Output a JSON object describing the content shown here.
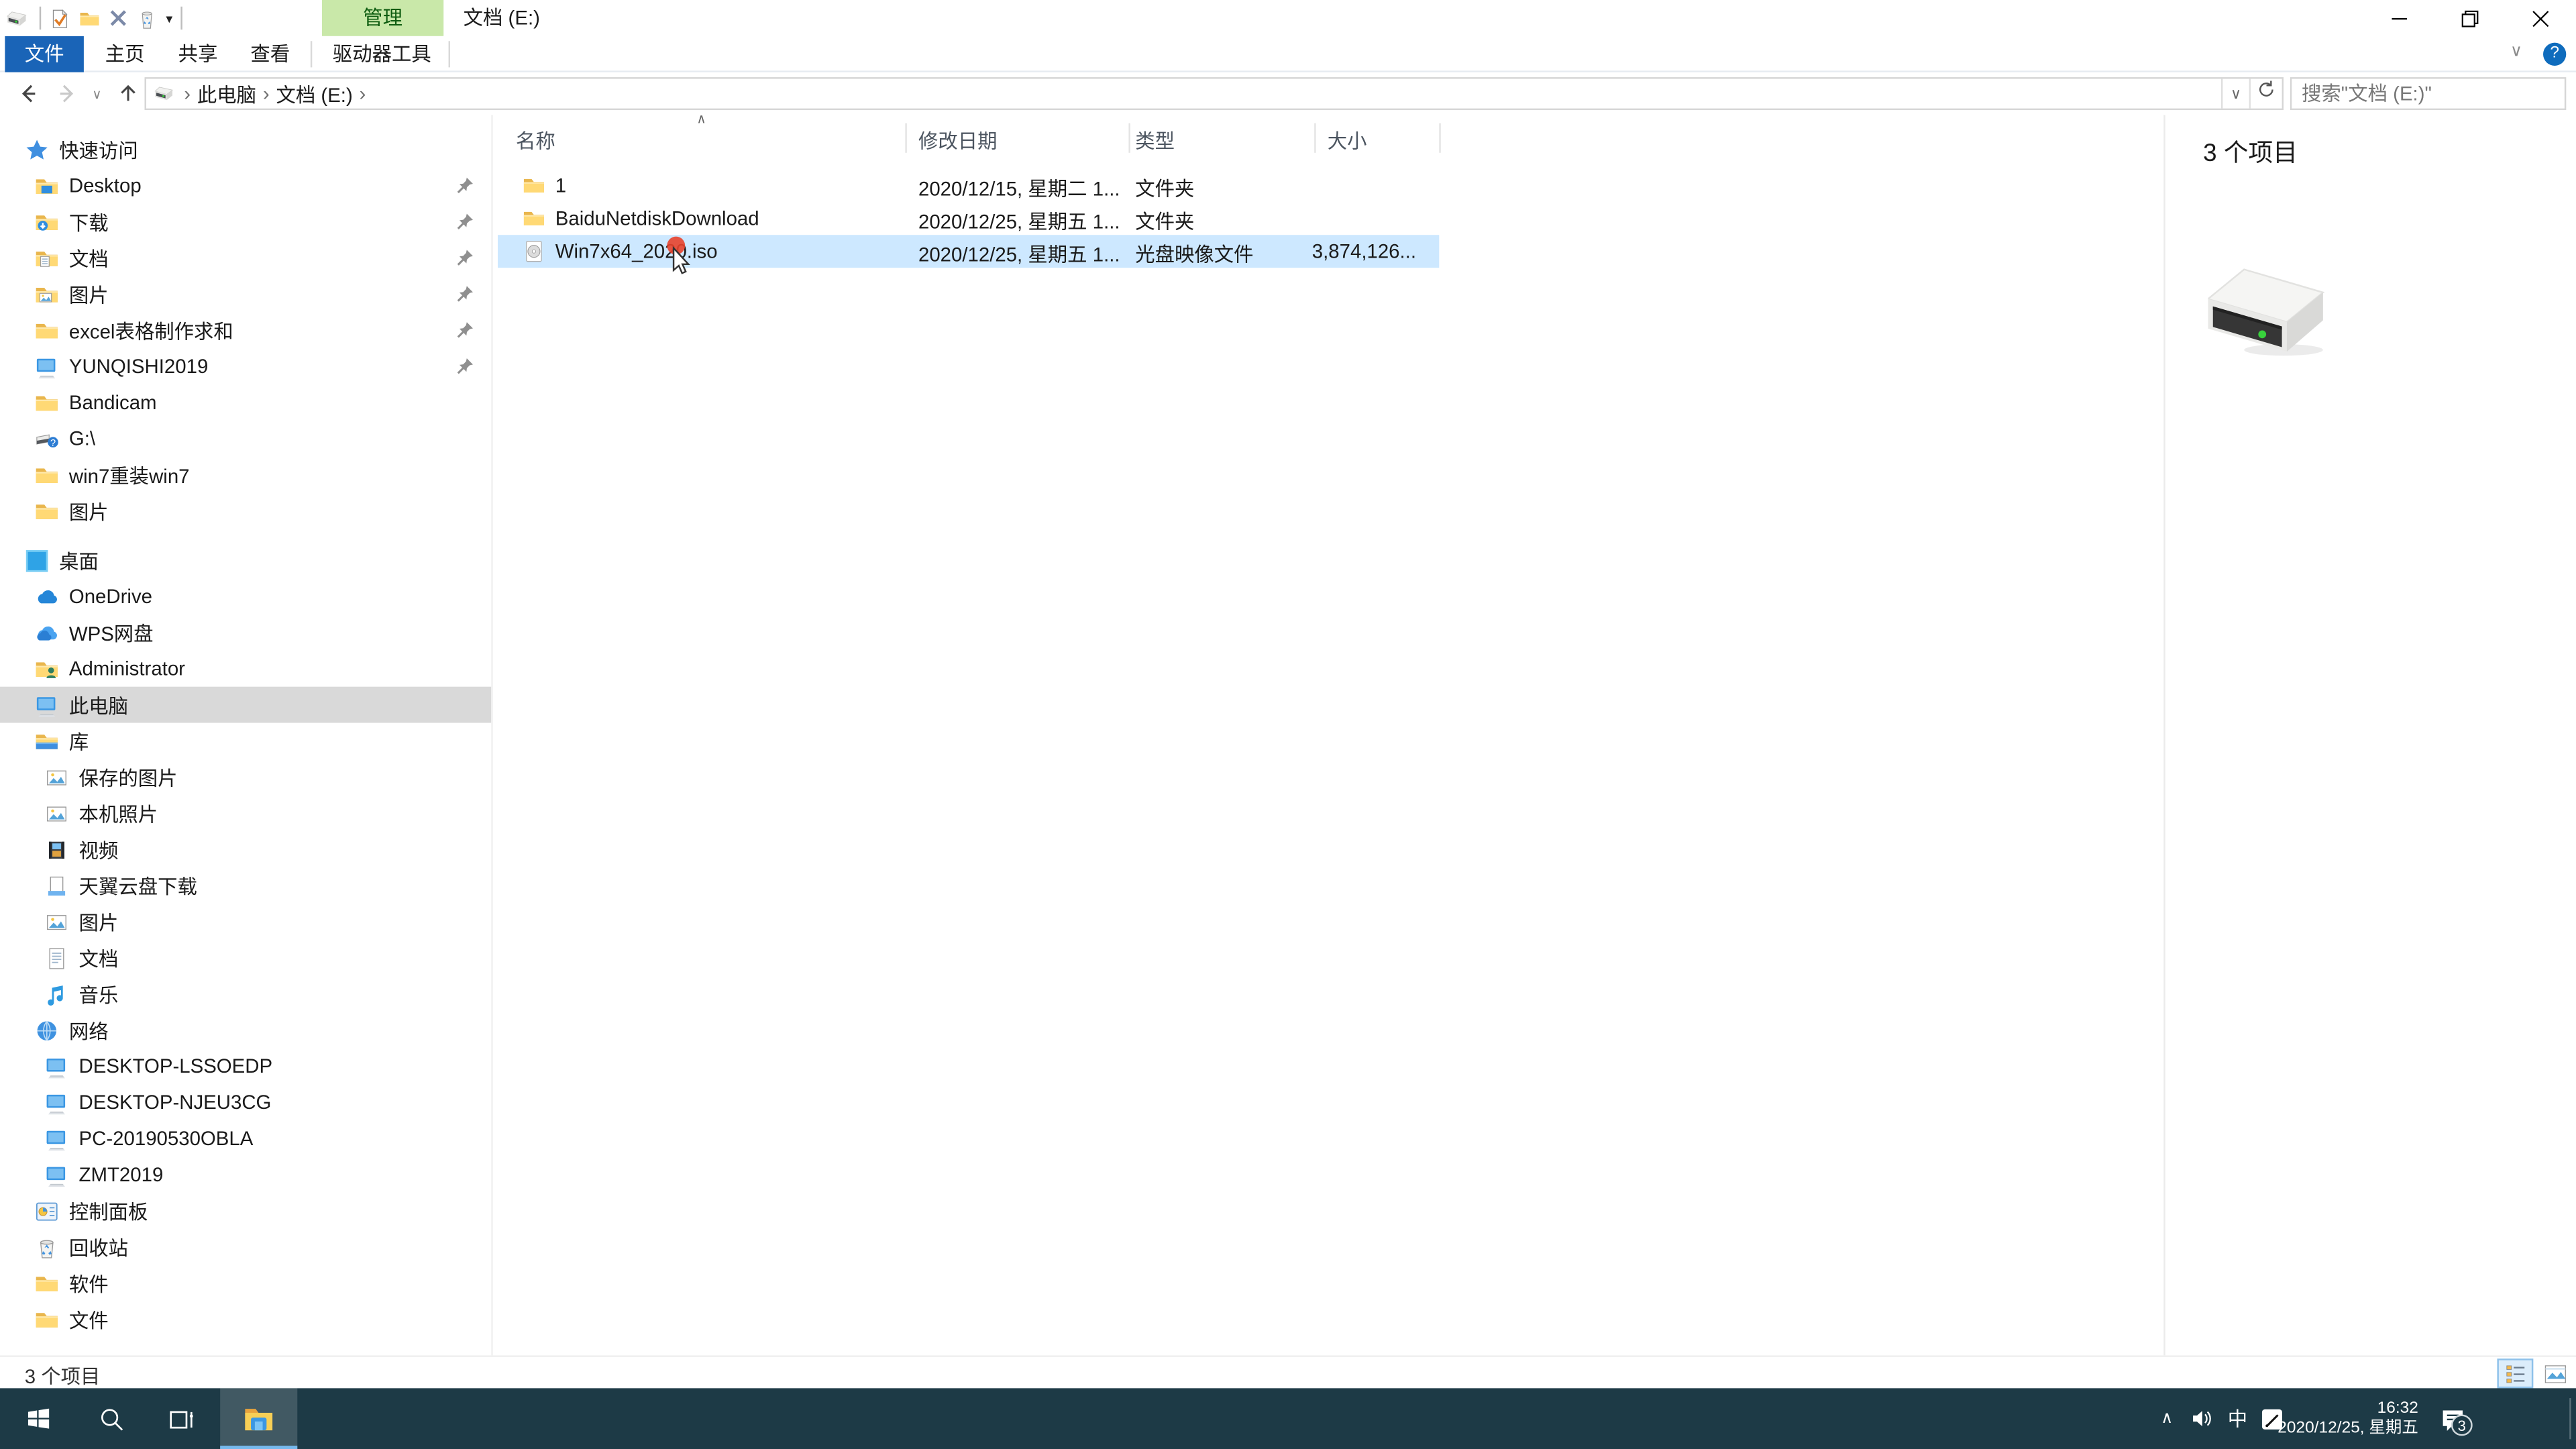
{
  "titlebar": {
    "contextual_header": "管理",
    "title": "文档 (E:)"
  },
  "ribbon": {
    "file_tab": "文件",
    "tabs": [
      "主页",
      "共享",
      "查看"
    ],
    "contextual_tab": "驱动器工具",
    "help_label": "?"
  },
  "nav": {
    "crumbs": [
      "此电脑",
      "文档 (E:)"
    ],
    "crumb_chevron": "›",
    "search_placeholder": "搜索\"文档 (E:)\""
  },
  "sidebar": {
    "items": [
      {
        "label": "快速访问",
        "icon": "star",
        "cls": "lv0",
        "pinned": false
      },
      {
        "label": "Desktop",
        "icon": "folder-desktop",
        "cls": "lv1",
        "pinned": true
      },
      {
        "label": "下载",
        "icon": "folder-down",
        "cls": "lv1",
        "pinned": true
      },
      {
        "label": "文档",
        "icon": "folder-doc",
        "cls": "lv1",
        "pinned": true
      },
      {
        "label": "图片",
        "icon": "folder-pic",
        "cls": "lv1",
        "pinned": true
      },
      {
        "label": "excel表格制作求和",
        "icon": "folder",
        "cls": "lv1",
        "pinned": true
      },
      {
        "label": "YUNQISHI2019",
        "icon": "pc",
        "cls": "lv1",
        "pinned": true
      },
      {
        "label": "Bandicam",
        "icon": "folder",
        "cls": "lv1",
        "pinned": false
      },
      {
        "label": "G:\\",
        "icon": "usb",
        "cls": "lv1",
        "pinned": false
      },
      {
        "label": "win7重装win7",
        "icon": "folder",
        "cls": "lv1",
        "pinned": false
      },
      {
        "label": "图片",
        "icon": "folder",
        "cls": "lv1",
        "pinned": false
      },
      {
        "label": "桌面",
        "icon": "desktop",
        "cls": "lv0 gap",
        "pinned": false
      },
      {
        "label": "OneDrive",
        "icon": "cloud",
        "cls": "lv1",
        "pinned": false
      },
      {
        "label": "WPS网盘",
        "icon": "wps",
        "cls": "lv1",
        "pinned": false
      },
      {
        "label": "Administrator",
        "icon": "folder-user",
        "cls": "lv1",
        "pinned": false
      },
      {
        "label": "此电脑",
        "icon": "pc",
        "cls": "lv1 selected-side",
        "pinned": false
      },
      {
        "label": "库",
        "icon": "library",
        "cls": "lv1",
        "pinned": false
      },
      {
        "label": "保存的图片",
        "icon": "pic",
        "cls": "lv2",
        "pinned": false
      },
      {
        "label": "本机照片",
        "icon": "pic",
        "cls": "lv2",
        "pinned": false
      },
      {
        "label": "视频",
        "icon": "video",
        "cls": "lv2",
        "pinned": false
      },
      {
        "label": "天翼云盘下载",
        "icon": "dl",
        "cls": "lv2",
        "pinned": false
      },
      {
        "label": "图片",
        "icon": "pic",
        "cls": "lv2",
        "pinned": false
      },
      {
        "label": "文档",
        "icon": "doc",
        "cls": "lv2",
        "pinned": false
      },
      {
        "label": "音乐",
        "icon": "music",
        "cls": "lv2",
        "pinned": false
      },
      {
        "label": "网络",
        "icon": "globe",
        "cls": "lv1",
        "pinned": false
      },
      {
        "label": "DESKTOP-LSSOEDP",
        "icon": "pc",
        "cls": "lv2",
        "pinned": false
      },
      {
        "label": "DESKTOP-NJEU3CG",
        "icon": "pc",
        "cls": "lv2",
        "pinned": false
      },
      {
        "label": "PC-20190530OBLA",
        "icon": "pc",
        "cls": "lv2",
        "pinned": false
      },
      {
        "label": "ZMT2019",
        "icon": "pc",
        "cls": "lv2",
        "pinned": false
      },
      {
        "label": "控制面板",
        "icon": "cpanel",
        "cls": "lv1",
        "pinned": false
      },
      {
        "label": "回收站",
        "icon": "bin",
        "cls": "lv1",
        "pinned": false
      },
      {
        "label": "软件",
        "icon": "folder",
        "cls": "lv1",
        "pinned": false
      },
      {
        "label": "文件",
        "icon": "folder",
        "cls": "lv1",
        "pinned": false
      }
    ]
  },
  "files": {
    "columns": [
      "名称",
      "修改日期",
      "类型",
      "大小"
    ],
    "sort_indicator": "∧",
    "rows": [
      {
        "icon": "folder",
        "name": "1",
        "date": "2020/12/15, 星期二 1...",
        "type": "文件夹",
        "size": "",
        "cls": ""
      },
      {
        "icon": "folder",
        "name": "BaiduNetdiskDownload",
        "date": "2020/12/25, 星期五 1...",
        "type": "文件夹",
        "size": "",
        "cls": ""
      },
      {
        "icon": "iso",
        "name": "Win7x64_2020.iso",
        "date": "2020/12/25, 星期五 1...",
        "type": "光盘映像文件",
        "size": "3,874,126...",
        "cls": "selected"
      }
    ]
  },
  "preview_pane": {
    "count": "3 个项目"
  },
  "statusbar": {
    "count": "3 个项目"
  },
  "taskbar": {
    "ime": "中",
    "time": "16:32",
    "date": "2020/12/25, 星期五",
    "badge": "3"
  },
  "colors": {
    "accent_blue": "#1a64b7",
    "contextual_green_bg": "#c9e8a9",
    "contextual_green_text": "#0e5c10",
    "taskbar_bg": "#1d3a46",
    "selection_blue": "#cde8ff",
    "sidebar_selected": "#d9d9d9"
  }
}
